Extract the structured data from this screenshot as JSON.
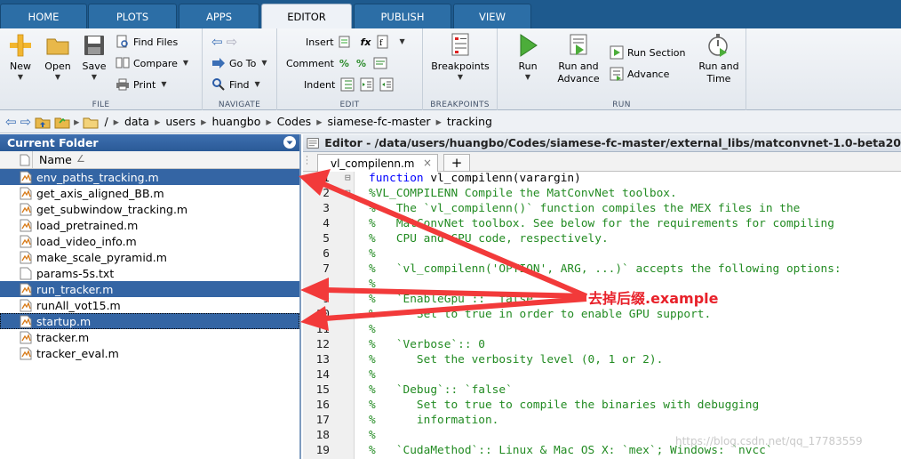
{
  "tabs": [
    "HOME",
    "PLOTS",
    "APPS",
    "EDITOR",
    "PUBLISH",
    "VIEW"
  ],
  "ribbon": {
    "file": {
      "label": "FILE",
      "new": "New",
      "open": "Open",
      "save": "Save",
      "find_files": "Find Files",
      "compare": "Compare",
      "print": "Print"
    },
    "navigate": {
      "label": "NAVIGATE",
      "go_to": "Go To",
      "find": "Find"
    },
    "edit": {
      "label": "EDIT",
      "insert": "Insert",
      "comment": "Comment",
      "indent": "Indent"
    },
    "breakpoints": {
      "label": "BREAKPOINTS",
      "breakpoints": "Breakpoints"
    },
    "run": {
      "label": "RUN",
      "run": "Run",
      "run_advance_1": "Run and",
      "run_advance_2": "Advance",
      "run_section": "Run Section",
      "advance": "Advance",
      "run_time_1": "Run and",
      "run_time_2": "Time"
    }
  },
  "address": {
    "root": "/",
    "path": [
      "data",
      "users",
      "huangbo",
      "Codes",
      "siamese-fc-master",
      "tracking"
    ]
  },
  "folder": {
    "title": "Current Folder",
    "column": "Name",
    "sort_indicator": "∠",
    "files": [
      {
        "name": "env_paths_tracking.m",
        "selected": true
      },
      {
        "name": "get_axis_aligned_BB.m",
        "selected": false
      },
      {
        "name": "get_subwindow_tracking.m",
        "selected": false
      },
      {
        "name": "load_pretrained.m",
        "selected": false
      },
      {
        "name": "load_video_info.m",
        "selected": false
      },
      {
        "name": "make_scale_pyramid.m",
        "selected": false
      },
      {
        "name": "params-5s.txt",
        "selected": false
      },
      {
        "name": "run_tracker.m",
        "selected": true
      },
      {
        "name": "runAll_vot15.m",
        "selected": false
      },
      {
        "name": "startup.m",
        "selected": true
      },
      {
        "name": "tracker.m",
        "selected": false
      },
      {
        "name": "tracker_eval.m",
        "selected": false
      }
    ]
  },
  "editor": {
    "title": "Editor - /data/users/huangbo/Codes/siamese-fc-master/external_libs/matconvnet-1.0-beta20",
    "tab": "vl_compilenn.m",
    "tab_close": "×",
    "new_tab": "+",
    "lines": [
      {
        "n": "1",
        "fold": "⊟",
        "kw": "function",
        "text": " vl_compilenn(varargin)",
        "type": "code"
      },
      {
        "n": "2",
        "fold": "⊟",
        "text": "%VL_COMPILENN Compile the MatConvNet toolbox.",
        "type": "comment"
      },
      {
        "n": "3",
        "text": "%   The `vl_compilenn()` function compiles the MEX files in the",
        "type": "comment"
      },
      {
        "n": "4",
        "text": "%   MatConvNet toolbox. See below for the requirements for compiling",
        "type": "comment"
      },
      {
        "n": "5",
        "text": "%   CPU and GPU code, respectively.",
        "type": "comment"
      },
      {
        "n": "6",
        "text": "%",
        "type": "comment"
      },
      {
        "n": "7",
        "text": "%   `vl_compilenn('OPTION', ARG, ...)` accepts the following options:",
        "type": "comment"
      },
      {
        "n": "8",
        "text": "%",
        "type": "comment"
      },
      {
        "n": "9",
        "text": "%   `EnableGpu`:: `false`",
        "type": "comment"
      },
      {
        "n": "10",
        "text": "%      Set to true in order to enable GPU support.",
        "type": "comment"
      },
      {
        "n": "11",
        "text": "%",
        "type": "comment"
      },
      {
        "n": "12",
        "text": "%   `Verbose`:: 0",
        "type": "comment"
      },
      {
        "n": "13",
        "text": "%      Set the verbosity level (0, 1 or 2).",
        "type": "comment"
      },
      {
        "n": "14",
        "text": "%",
        "type": "comment"
      },
      {
        "n": "15",
        "text": "%   `Debug`:: `false`",
        "type": "comment"
      },
      {
        "n": "16",
        "text": "%      Set to true to compile the binaries with debugging",
        "type": "comment"
      },
      {
        "n": "17",
        "text": "%      information.",
        "type": "comment"
      },
      {
        "n": "18",
        "text": "%",
        "type": "comment"
      },
      {
        "n": "19",
        "text": "%   `CudaMethod`:: Linux & Mac OS X: `mex`; Windows: `nvcc`",
        "type": "comment"
      }
    ]
  },
  "annotation": {
    "label": "去掉后缀.example",
    "color": "#e8212a"
  },
  "watermark": "https://blog.csdn.net/qq_17783559",
  "colors": {
    "tab_bar": "#1e5a8e",
    "selection": "#3465a4",
    "comment": "#228b22",
    "keyword": "#0000ff"
  }
}
